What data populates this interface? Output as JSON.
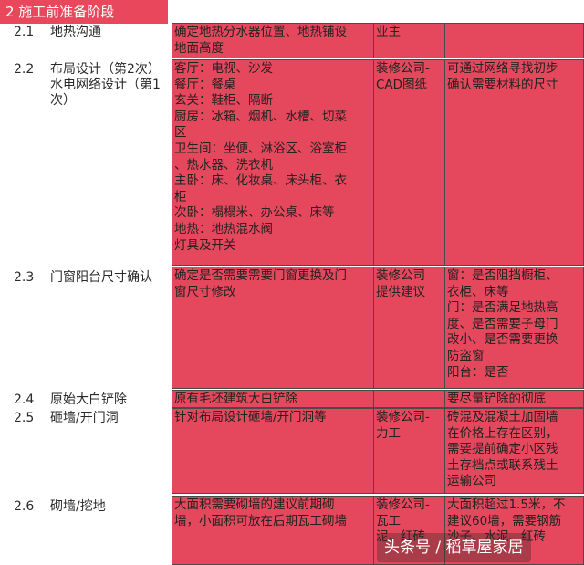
{
  "section_title": "2 施工前准备阶段",
  "rows": [
    {
      "num": "2.1",
      "name": [
        "地热沟通"
      ],
      "content": [
        "确定地热分水器位置、地热铺设",
        "地面高度"
      ],
      "party": [
        "业主"
      ],
      "note": []
    },
    {
      "num": "2.2",
      "name": [
        "布局设计（第2次）",
        "水电网络设计（第1",
        "次）"
      ],
      "content": [
        "客厅：电视、沙发",
        "餐厅：餐桌",
        "玄关：鞋柜、隔断",
        "厨房：冰箱、烟机、水槽、切菜",
        "区",
        "卫生间：坐便、淋浴区、浴室柜",
        "、热水器、洗衣机",
        "主卧：床、化妆桌、床头柜、衣",
        "柜",
        "次卧：榻榻米、办公桌、床等",
        "地热：地热混水阀",
        "灯具及开关"
      ],
      "party": [
        "装修公司-",
        "CAD图纸"
      ],
      "note": [
        "可通过网络寻找初步",
        "确认需要材料的尺寸"
      ]
    },
    {
      "num": "2.3",
      "name": [
        "门窗阳台尺寸确认"
      ],
      "content": [
        "确定是否需要需要门窗更换及门",
        "窗尺寸修改"
      ],
      "party": [
        "装修公司",
        "提供建议"
      ],
      "note": [
        "窗：是否阻挡橱柜、",
        "衣柜、床等",
        "门：是否满足地热高",
        "度、是否需要子母门",
        "改小、是否需要更换",
        "防盗窗",
        "阳台：是否"
      ]
    },
    {
      "num": "2.4",
      "name": [
        "原始大白铲除"
      ],
      "content": [
        "原有毛坯建筑大白铲除"
      ],
      "party": [],
      "note": [
        "要尽量铲除的彻底"
      ]
    },
    {
      "num": "2.5",
      "name": [
        "砸墙/开门洞"
      ],
      "content": [
        "针对布局设计砸墙/开门洞等"
      ],
      "party": [
        "装修公司-",
        "力工"
      ],
      "note": [
        "砖混及混凝土加固墙",
        "在价格上存在区别，",
        "需要提前确定小区残",
        "土存档点或联系残土",
        "运输公司"
      ]
    },
    {
      "num": "2.6",
      "name": [
        "砌墙/挖地"
      ],
      "content": [
        "大面积需要砌墙的建议前期砌",
        "墙，小面积可放在后期瓦工砌墙"
      ],
      "party": [
        "装修公司-",
        "瓦工",
        "泥、红砖"
      ],
      "note": [
        "大面积超过1.5米，不",
        "建议60墙，需要钢筋",
        "沙子、水泥、红砖"
      ]
    }
  ],
  "watermark": "头条号 / 稻草屋家居"
}
